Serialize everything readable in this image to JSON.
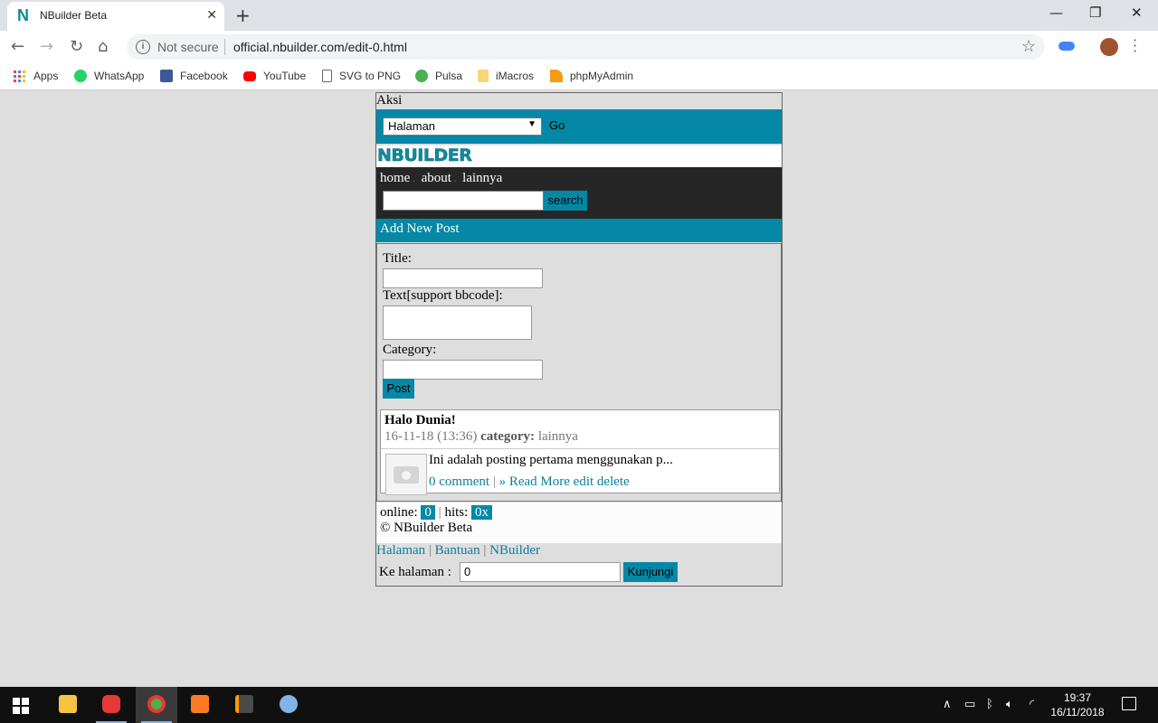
{
  "browser": {
    "tab_title": "NBuilder Beta",
    "tab_favicon": "N",
    "tab_close": "✕",
    "new_tab": "+",
    "window_controls": {
      "minimize": "—",
      "restore": "❐",
      "close": "✕"
    },
    "security_label": "Not secure",
    "url": "official.nbuilder.com/edit-0.html",
    "bookmarks": [
      "Apps",
      "WhatsApp",
      "Facebook",
      "YouTube",
      "SVG to PNG",
      "Pulsa",
      "iMacros",
      "phpMyAdmin"
    ]
  },
  "page": {
    "aksi_label": "Aksi",
    "aksi_select_value": "Halaman",
    "go_label": "Go",
    "logo_text": "NBUILDER",
    "nav": [
      "home",
      "about",
      "lainnya"
    ],
    "search_button": "search",
    "section_title": "Add New Post",
    "form": {
      "title_label": "Title:",
      "text_label": "Text[support bbcode]:",
      "category_label": "Category:",
      "post_button": "Post"
    },
    "post": {
      "title": "Halo Dunia!",
      "date": "16-11-18 (13:36)",
      "category_label": "category:",
      "category_value": "lainnya",
      "excerpt": "Ini adalah posting pertama menggunakan p...",
      "comment_link": "0 comment",
      "pipe": "|",
      "read_more": "» Read More",
      "edit": "edit",
      "delete": "delete"
    },
    "footer": {
      "online_label": "online:",
      "online_count": "0",
      "hits_label": "hits:",
      "hits_count": "0x",
      "separator": "|",
      "copyright": "© NBuilder Beta",
      "links": [
        "Halaman",
        "Bantuan",
        "NBuilder"
      ],
      "goto_label": "Ke halaman :",
      "goto_value": "0",
      "goto_button": "Kunjungi"
    }
  },
  "taskbar": {
    "clock_time": "19:37",
    "clock_date": "16/11/2018"
  },
  "colors": {
    "accent": "#0488a6",
    "nav_dark": "#262626",
    "link": "#0a7fa0",
    "page_bg": "#dedede"
  }
}
